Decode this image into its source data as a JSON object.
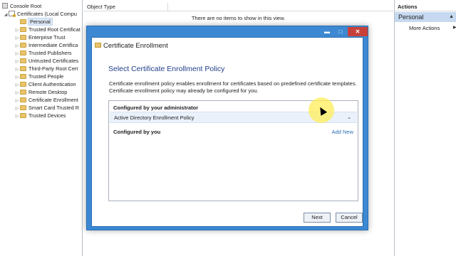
{
  "tree": {
    "items": [
      {
        "label": "Console Root",
        "icon": "console-root-icon",
        "expander": ""
      },
      {
        "label": "Certificates (Local Compu",
        "icon": "certificates-icon",
        "expander": "◢"
      },
      {
        "label": "Personal",
        "icon": "folder-icon",
        "expander": "",
        "selected": true
      },
      {
        "label": "Trusted Root Certificat",
        "icon": "folder-icon",
        "expander": "▷"
      },
      {
        "label": "Enterprise Trust",
        "icon": "folder-icon",
        "expander": "▷"
      },
      {
        "label": "Intermediate Certifica",
        "icon": "folder-icon",
        "expander": "▷"
      },
      {
        "label": "Trusted Publishers",
        "icon": "folder-icon",
        "expander": "▷"
      },
      {
        "label": "Untrusted Certificates",
        "icon": "folder-icon",
        "expander": "▷"
      },
      {
        "label": "Third-Party Root Cert",
        "icon": "folder-icon",
        "expander": "▷"
      },
      {
        "label": "Trusted People",
        "icon": "folder-icon",
        "expander": "▷"
      },
      {
        "label": "Client Authentication",
        "icon": "folder-icon",
        "expander": "▷"
      },
      {
        "label": "Remote Desktop",
        "icon": "folder-icon",
        "expander": "▷"
      },
      {
        "label": "Certificate Enrollment",
        "icon": "folder-icon",
        "expander": "▷"
      },
      {
        "label": "Smart Card Trusted R",
        "icon": "folder-icon",
        "expander": "▷"
      },
      {
        "label": "Trusted Devices",
        "icon": "folder-icon",
        "expander": "▷"
      }
    ]
  },
  "center": {
    "column_header": "Object Type",
    "empty_message": "There are no items to show in this view."
  },
  "actions": {
    "title": "Actions",
    "selected": "Personal",
    "more_actions": "More Actions",
    "caret": "▲",
    "more_arrow": "▶"
  },
  "dialog": {
    "title": "Certificate Enrollment",
    "window_buttons": {
      "minimize": "▬",
      "maximize": "□",
      "close": "✕"
    },
    "heading": "Select Certificate Enrollment Policy",
    "description": "Certificate enrollment policy enables enrollment for certificates based on predefined certificate templates. Certificate enrollment policy may already be configured for you.",
    "admin_header": "Configured by your administrator",
    "admin_policy": "Active Directory Enrollment Policy",
    "admin_chevron": "⌄",
    "you_header": "Configured by you",
    "add_new": "Add New",
    "next": "Next",
    "cancel": "Cancel"
  },
  "colors": {
    "dialog_frame": "#3c88d2",
    "close_button": "#c7413a",
    "heading_text": "#1f3f8a",
    "selection": "#c6d9f0",
    "cursor_highlight": "#ffee5a"
  }
}
